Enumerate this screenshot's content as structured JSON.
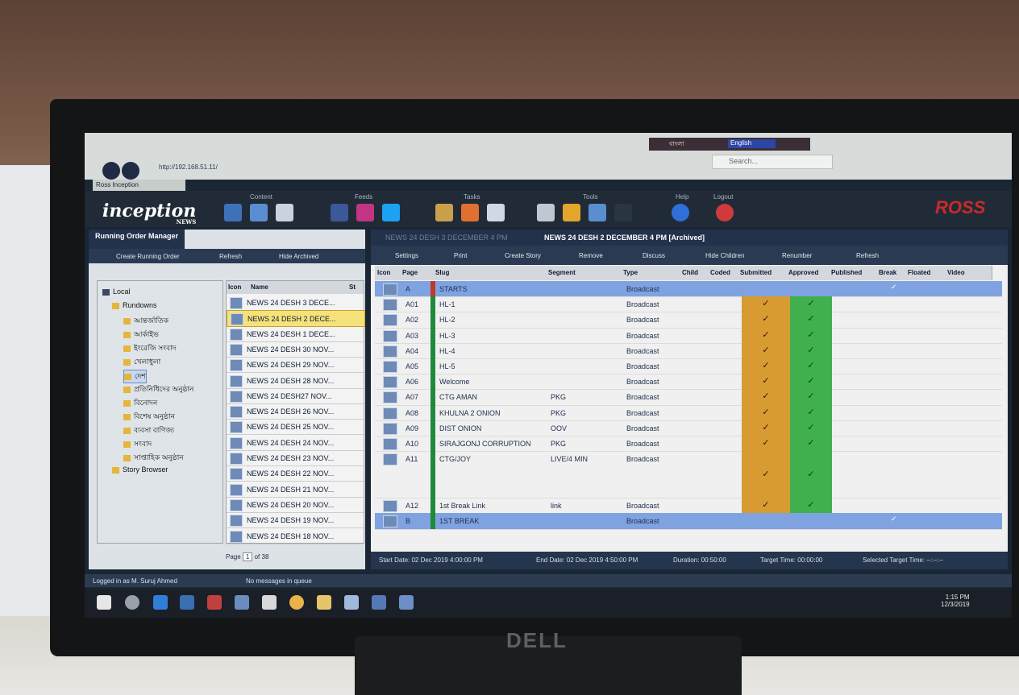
{
  "browser": {
    "url": "http://192.168.51.11/",
    "tab_title": "Ross Inception",
    "search_placeholder": "Search...",
    "language_bengali": "বাংলা",
    "language_english": "English"
  },
  "app": {
    "logo_text": "inception",
    "logo_sub": "NEWS",
    "brand": "ROSS",
    "groups": {
      "content": "Content",
      "feeds": "Feeds",
      "tasks": "Tasks",
      "tools": "Tools",
      "help": "Help",
      "logout": "Logout"
    }
  },
  "left_panel": {
    "title": "Running Order Manager",
    "create_label": "Create Running Order",
    "refresh_label": "Refresh",
    "hide_archived_label": "Hide Archived",
    "tree": {
      "local": "Local",
      "rundowns": "Rundowns",
      "items": [
        "আন্তর্জাতিক",
        "আর্কাইভ",
        "ইংরেজি সংবাদ",
        "খেলাধুলা",
        "দেশ",
        "প্রতিনিধিদের অনুষ্ঠান",
        "বিনোদন",
        "বিশেষ অনুষ্ঠান",
        "ব্যবসা বাণিজ্য",
        "সংবাদ",
        "সাপ্তাহিক অনুষ্ঠান"
      ],
      "story_browser": "Story Browser"
    },
    "list_headers": {
      "icon": "Icon",
      "name": "Name",
      "status": "St"
    },
    "rundowns": [
      "NEWS 24 DESH 3 DECE...",
      "NEWS 24 DESH 2 DECE...",
      "NEWS 24 DESH 1 DECE...",
      "NEWS 24 DESH 30 NOV...",
      "NEWS 24 DESH 29 NOV...",
      "NEWS 24 DESH 28 NOV...",
      "NEWS 24 DESH27 NOV...",
      "NEWS 24 DESH 26 NOV...",
      "NEWS 24 DESH 25 NOV...",
      "NEWS 24 DESH 24 NOV...",
      "NEWS 24 DESH 23 NOV...",
      "NEWS 24 DESH 22 NOV...",
      "NEWS 24 DESH 21 NOV...",
      "NEWS 24 DESH 20 NOV...",
      "NEWS 24 DESH 19 NOV...",
      "NEWS 24 DESH 18 NOV..."
    ],
    "selected_index": 1,
    "pager": {
      "label": "Page",
      "page": "1",
      "of": "of 38"
    }
  },
  "right_panel": {
    "tab_inactive": "NEWS 24 DESH 3 DECEMBER 4 PM",
    "tab_active": "NEWS 24 DESH 2 DECEMBER 4 PM [Archived]",
    "toolbar": [
      "Settings",
      "Print",
      "Create Story",
      "Remove",
      "Discuss",
      "Hide Children",
      "Renumber",
      "Refresh"
    ],
    "columns": [
      "Icon",
      "Page",
      "Slug",
      "Segment",
      "Type",
      "Child",
      "Coded",
      "Submitted",
      "Approved",
      "Published",
      "Break",
      "Floated",
      "Video"
    ],
    "rows": [
      {
        "page": "A",
        "slug": "STARTS",
        "segment": "",
        "type": "Broadcast",
        "submitted": false,
        "approved": false,
        "break": true,
        "kind": "header"
      },
      {
        "page": "A01",
        "slug": "HL-1",
        "segment": "",
        "type": "Broadcast",
        "submitted": true,
        "approved": true
      },
      {
        "page": "A02",
        "slug": "HL-2",
        "segment": "",
        "type": "Broadcast",
        "submitted": true,
        "approved": true
      },
      {
        "page": "A03",
        "slug": "HL-3",
        "segment": "",
        "type": "Broadcast",
        "submitted": true,
        "approved": true
      },
      {
        "page": "A04",
        "slug": "HL-4",
        "segment": "",
        "type": "Broadcast",
        "submitted": true,
        "approved": true
      },
      {
        "page": "A05",
        "slug": "HL-5",
        "segment": "",
        "type": "Broadcast",
        "submitted": true,
        "approved": true
      },
      {
        "page": "A06",
        "slug": "Welcome",
        "segment": "",
        "type": "Broadcast",
        "submitted": true,
        "approved": true
      },
      {
        "page": "A07",
        "slug": "CTG AMAN",
        "segment": "PKG",
        "type": "Broadcast",
        "submitted": true,
        "approved": true
      },
      {
        "page": "A08",
        "slug": "KHULNA 2 ONION",
        "segment": "PKG",
        "type": "Broadcast",
        "submitted": true,
        "approved": true
      },
      {
        "page": "A09",
        "slug": "DIST ONION",
        "segment": "OOV",
        "type": "Broadcast",
        "submitted": true,
        "approved": true
      },
      {
        "page": "A10",
        "slug": "SIRAJGONJ CORRUPTION",
        "segment": "PKG",
        "type": "Broadcast",
        "submitted": true,
        "approved": true
      },
      {
        "page": "A11",
        "slug": "CTG/JOY",
        "segment": "LIVE/4 MIN",
        "type": "Broadcast",
        "submitted": true,
        "approved": true,
        "tall": true
      },
      {
        "page": "A12",
        "slug": "1st Break Link",
        "segment": "link",
        "type": "Broadcast",
        "submitted": true,
        "approved": true
      },
      {
        "page": "B",
        "slug": "1ST BREAK",
        "segment": "",
        "type": "Broadcast",
        "submitted": false,
        "approved": false,
        "break": true,
        "kind": "header"
      }
    ],
    "status": {
      "start": "Start Date: 02 Dec 2019 4:00:00 PM",
      "end": "End Date: 02 Dec 2019 4:50:00 PM",
      "duration": "Duration: 00:50:00",
      "target": "Target Time: 00:00:00",
      "selected_target": "Selected Target Time: --:--:--"
    }
  },
  "status_bar": {
    "logged_in": "Logged in as M. Suruj Ahmed",
    "messages": "No messages in queue"
  },
  "taskbar": {
    "time": "1:15 PM",
    "date": "12/3/2019"
  },
  "colors": {
    "submitted": "#d79b32",
    "approved": "#3fb04d",
    "header_row": "#7fa3e0",
    "accent": "#22324a"
  }
}
